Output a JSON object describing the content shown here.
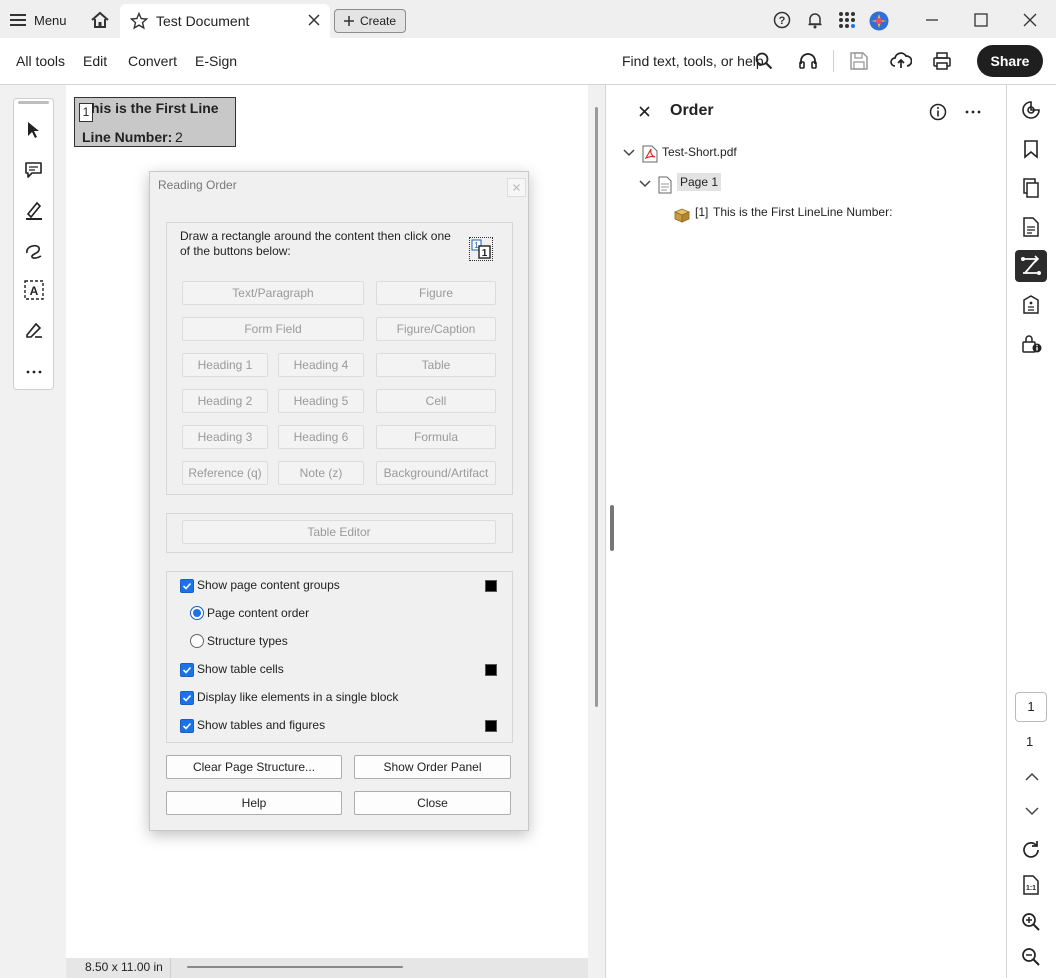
{
  "titlebar": {
    "menu_label": "Menu",
    "tab_title": "Test Document",
    "create_label": "Create"
  },
  "toolbar": {
    "items": [
      "All tools",
      "Edit",
      "Convert",
      "E-Sign"
    ],
    "search_label": "Find text, tools, or help",
    "share_label": "Share"
  },
  "document": {
    "first_line": "his is the First Line",
    "line_number_label": "Line Number:",
    "line_number_value": "2",
    "order_badge": "1",
    "page_size": "8.50 x 11.00 in"
  },
  "dialog": {
    "title": "Reading Order",
    "instructions": "Draw a rectangle around the content then click one of the buttons below:",
    "buttons": {
      "text_paragraph": "Text/Paragraph",
      "figure": "Figure",
      "form_field": "Form Field",
      "figure_caption": "Figure/Caption",
      "heading1": "Heading 1",
      "heading4": "Heading 4",
      "table": "Table",
      "heading2": "Heading 2",
      "heading5": "Heading 5",
      "cell": "Cell",
      "heading3": "Heading 3",
      "heading6": "Heading 6",
      "formula": "Formula",
      "reference": "Reference (q)",
      "note": "Note (z)",
      "background": "Background/Artifact",
      "table_editor": "Table Editor"
    },
    "options": {
      "show_groups": "Show page content groups",
      "page_content_order": "Page content order",
      "structure_types": "Structure types",
      "show_table_cells": "Show table cells",
      "display_like": "Display like elements in a single block",
      "show_tables_figures": "Show tables and figures"
    },
    "actions": {
      "clear": "Clear Page Structure...",
      "show_order": "Show Order Panel",
      "help": "Help",
      "close": "Close"
    }
  },
  "order_panel": {
    "title": "Order",
    "file": "Test-Short.pdf",
    "page": "Page 1",
    "item_index": "[1]",
    "item_text": "This is the First LineLine Number:"
  },
  "page_nav": {
    "current_page": "1",
    "total_pages": "1"
  },
  "colors": {
    "accent": "#1a73e8",
    "share_bg": "#1f1f1f"
  }
}
